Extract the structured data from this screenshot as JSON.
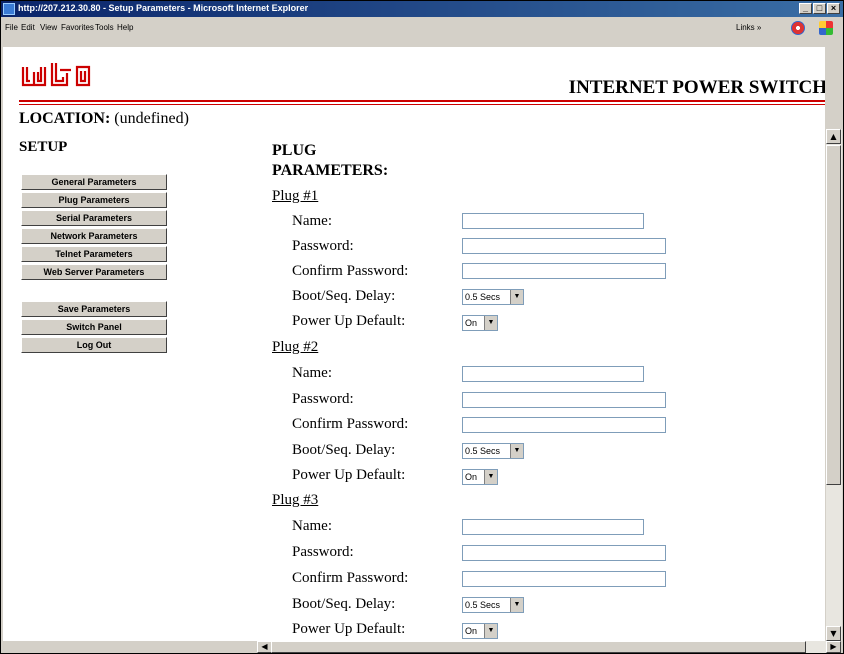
{
  "window": {
    "title": "http://207.212.30.80 - Setup Parameters - Microsoft Internet Explorer",
    "min_label": "_",
    "max_label": "□",
    "close_label": "×"
  },
  "menu": [
    "File",
    "Edit",
    "View",
    "Favorites",
    "Tools",
    "Help"
  ],
  "toolbar": {
    "links_label": "Links »"
  },
  "header": {
    "logo_text": "wti",
    "product": "INTERNET POWER SWITCH",
    "location_label": "LOCATION:",
    "location_value": "(undefined)",
    "accent_color": "#cc0000"
  },
  "sidebar": {
    "heading": "SETUP",
    "nav": [
      "General Parameters",
      "Plug Parameters",
      "Serial Parameters",
      "Network Parameters",
      "Telnet Parameters",
      "Web Server Parameters"
    ],
    "actions": [
      "Save Parameters",
      "Switch Panel",
      "Log Out"
    ]
  },
  "main": {
    "heading": "PLUG PARAMETERS:",
    "field_labels": {
      "name": "Name:",
      "password": "Password:",
      "confirm": "Confirm Password:",
      "delay": "Boot/Seq. Delay:",
      "power": "Power Up Default:"
    },
    "plugs": [
      {
        "label": "Plug #1",
        "name": "",
        "password": "",
        "confirm": "",
        "delay": "0.5 Secs",
        "power": "On"
      },
      {
        "label": "Plug #2",
        "name": "",
        "password": "",
        "confirm": "",
        "delay": "0.5 Secs",
        "power": "On"
      },
      {
        "label": "Plug #3",
        "name": "",
        "password": "",
        "confirm": "",
        "delay": "0.5 Secs",
        "power": "On"
      }
    ]
  }
}
